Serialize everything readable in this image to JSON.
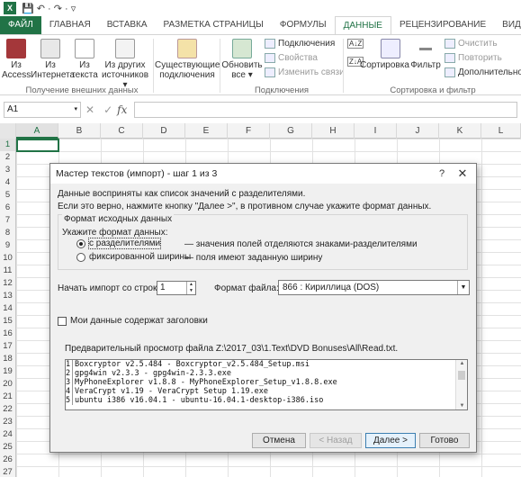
{
  "quick_access": "💾  ↶ · ↷ · ▿",
  "ribbon_tabs": [
    "ФАЙЛ",
    "ГЛАВНАЯ",
    "ВСТАВКА",
    "РАЗМЕТКА СТРАНИЦЫ",
    "ФОРМУЛЫ",
    "ДАННЫЕ",
    "РЕЦЕНЗИРОВАНИЕ",
    "ВИД"
  ],
  "ribbon": {
    "get_external": {
      "from_access": "Из\nAccess",
      "from_web": "Из\nИнтернета",
      "from_text": "Из\nтекста",
      "from_other": "Из других\nисточников ▾",
      "existing": "Существующие\nподключения",
      "group_label": "Получение внешних данных"
    },
    "connections": {
      "refresh_all": "Обновить\nвсе ▾",
      "connections": "Подключения",
      "properties": "Свойства",
      "edit_links": "Изменить связи",
      "group_label": "Подключения"
    },
    "sort_filter": {
      "sort": "Сортировка",
      "filter": "Фильтр",
      "clear": "Очистить",
      "reapply": "Повторить",
      "advanced": "Дополнительно",
      "group_label": "Сортировка и фильтр"
    }
  },
  "formula_bar": {
    "name_box": "A1",
    "cancel": "✕",
    "enter": "✓",
    "fx": "fx",
    "value": ""
  },
  "sheet": {
    "columns": [
      "A",
      "B",
      "C",
      "D",
      "E",
      "F",
      "G",
      "H",
      "I",
      "J",
      "K",
      "L"
    ],
    "rows": [
      "1",
      "2",
      "3",
      "4",
      "5",
      "6",
      "7",
      "8",
      "9",
      "10",
      "11",
      "12",
      "13",
      "14",
      "15",
      "16",
      "17",
      "18",
      "19",
      "20",
      "21",
      "22",
      "23",
      "24",
      "25",
      "26",
      "27"
    ],
    "active_cell": "A1"
  },
  "dialog": {
    "title": "Мастер текстов (импорт) - шаг 1 из 3",
    "help_button": "?",
    "close_button": "✕",
    "intro_line1": "Данные восприняты как список значений с разделителями.",
    "intro_line2": "Если это верно, нажмите кнопку \"Далее >\", в противном случае укажите формат данных.",
    "source_format_legend": "Формат исходных данных",
    "specify_format": "Укажите формат данных:",
    "opt_delimited": "с разделителями",
    "opt_delimited_desc": "— значения полей отделяются знаками-разделителями",
    "opt_fixed": "фиксированной ширины",
    "opt_fixed_desc": "— поля имеют заданную ширину",
    "start_row_label": "Начать импорт со строки:",
    "start_row_value": "1",
    "file_format_label": "Формат файла:",
    "file_format_value": "866 : Кириллица (DOS)",
    "headers_checkbox": "Мои данные содержат заголовки",
    "preview_label": "Предварительный просмотр файла Z:\\2017_03\\1.Text\\DVD Bonuses\\All\\Read.txt.",
    "preview_lines": [
      {
        "num": "1",
        "text": "Boxcryptor v2.5.484 - Boxcryptor_v2.5.484_Setup.msi"
      },
      {
        "num": "2",
        "text": "gpg4win v2.3.3 - gpg4win-2.3.3.exe"
      },
      {
        "num": "3",
        "text": "MyPhoneExplorer v1.8.8 - MyPhoneExplorer_Setup_v1.8.8.exe"
      },
      {
        "num": "4",
        "text": "VeraCrypt v1.19 - VeraCrypt Setup 1.19.exe"
      },
      {
        "num": "5",
        "text": "ubuntu i386 v16.04.1 - ubuntu-16.04.1-desktop-i386.iso"
      }
    ],
    "btn_cancel": "Отмена",
    "btn_back": "< Назад",
    "btn_next": "Далее >",
    "btn_finish": "Готово"
  },
  "colors": {
    "excel_green": "#217346",
    "dialog_bg": "#f0f0f0",
    "default_button_border": "#3c7fb1"
  }
}
